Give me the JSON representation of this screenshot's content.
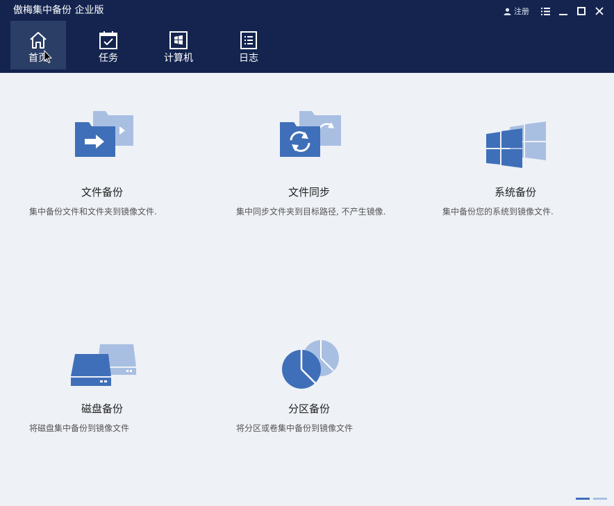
{
  "app": {
    "title": "傲梅集中备份 企业版"
  },
  "window": {
    "register_label": "注册"
  },
  "nav": {
    "items": [
      {
        "label": "首页",
        "icon": "home-icon",
        "active": true
      },
      {
        "label": "任务",
        "icon": "task-icon"
      },
      {
        "label": "计算机",
        "icon": "computer-icon"
      },
      {
        "label": "日志",
        "icon": "log-icon"
      }
    ]
  },
  "cards": [
    {
      "title": "文件备份",
      "desc": "集中备份文件和文件夹到镜像文件.",
      "icon": "file-backup-icon"
    },
    {
      "title": "文件同步",
      "desc": "集中同步文件夹到目标路径, 不产生镜像.",
      "icon": "file-sync-icon"
    },
    {
      "title": "系统备份",
      "desc": "集中备份您的系统到镜像文件.",
      "icon": "system-backup-icon"
    },
    {
      "title": "磁盘备份",
      "desc": "将磁盘集中备份到镜像文件",
      "icon": "disk-backup-icon"
    },
    {
      "title": "分区备份",
      "desc": "将分区或卷集中备份到镜像文件",
      "icon": "partition-backup-icon"
    }
  ],
  "pager": {
    "pages": 2,
    "current": 1
  },
  "colors": {
    "header_bg": "#14244f",
    "active_tab_bg": "#2b3e66",
    "icon_primary": "#3f6fb8",
    "icon_secondary": "#a9bfe2",
    "content_bg": "#eef1f6"
  }
}
